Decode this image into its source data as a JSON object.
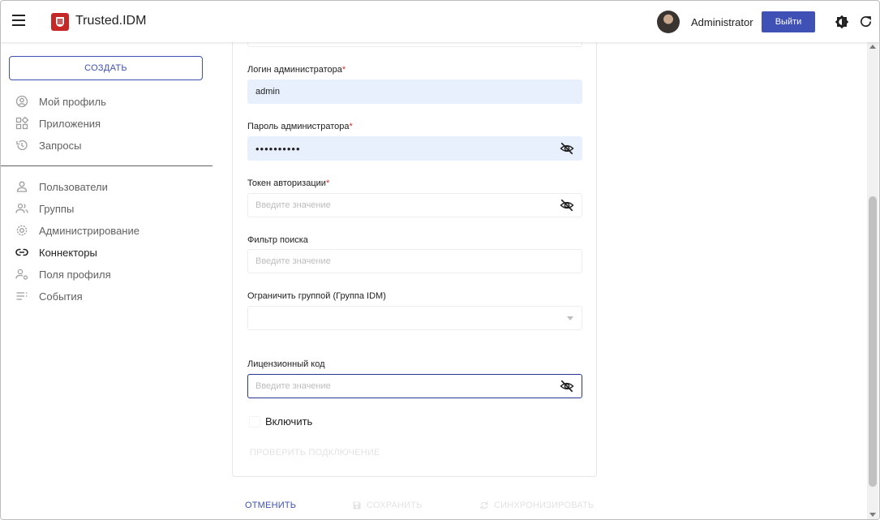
{
  "header": {
    "app_title": "Trusted.IDM",
    "user_name": "Administrator",
    "logout_label": "Выйти",
    "icons": [
      "menu-icon",
      "logo-icon",
      "avatar",
      "theme-icon",
      "refresh-icon"
    ]
  },
  "sidebar": {
    "create_label": "СОЗДАТЬ",
    "items": [
      {
        "label": "Мой профиль",
        "icon": "user-circle-icon"
      },
      {
        "label": "Приложения",
        "icon": "apps-icon"
      },
      {
        "label": "Запросы",
        "icon": "history-icon"
      },
      {
        "label": "Пользователи",
        "icon": "user-icon"
      },
      {
        "label": "Группы",
        "icon": "group-icon"
      },
      {
        "label": "Администрирование",
        "icon": "gear-icon"
      },
      {
        "label": "Коннекторы",
        "icon": "link-icon"
      },
      {
        "label": "Поля профиля",
        "icon": "profile-fields-icon"
      },
      {
        "label": "События",
        "icon": "list-icon"
      }
    ],
    "active_item": "Коннекторы"
  },
  "form": {
    "admin_login": {
      "label": "Логин администратора",
      "required": "*",
      "value": "admin"
    },
    "admin_password": {
      "label": "Пароль администратора",
      "required": "*",
      "value": "••••••••••"
    },
    "auth_token": {
      "label": "Токен авторизации",
      "required": "*",
      "placeholder": "Введите значение"
    },
    "search_filter": {
      "label": "Фильтр поиска",
      "placeholder": "Введите значение"
    },
    "group_limit": {
      "label": "Ограничить группой (Группа IDM)",
      "value": ""
    },
    "license_code": {
      "label": "Лицензионный код",
      "placeholder": "Введите значение"
    },
    "enable_label": "Включить",
    "test_connection_label": "ПРОВЕРИТЬ ПОДКЛЮЧЕНИЕ"
  },
  "footer": {
    "cancel_label": "ОТМЕНИТЬ",
    "save_label": "СОХРАНИТЬ",
    "sync_label": "СИНХРОНИЗИРОВАТЬ"
  },
  "colors": {
    "accent": "#3f51b5",
    "required": "#d32f2f",
    "filled_bg": "#e8f0fe",
    "focus_border": "#283593"
  }
}
